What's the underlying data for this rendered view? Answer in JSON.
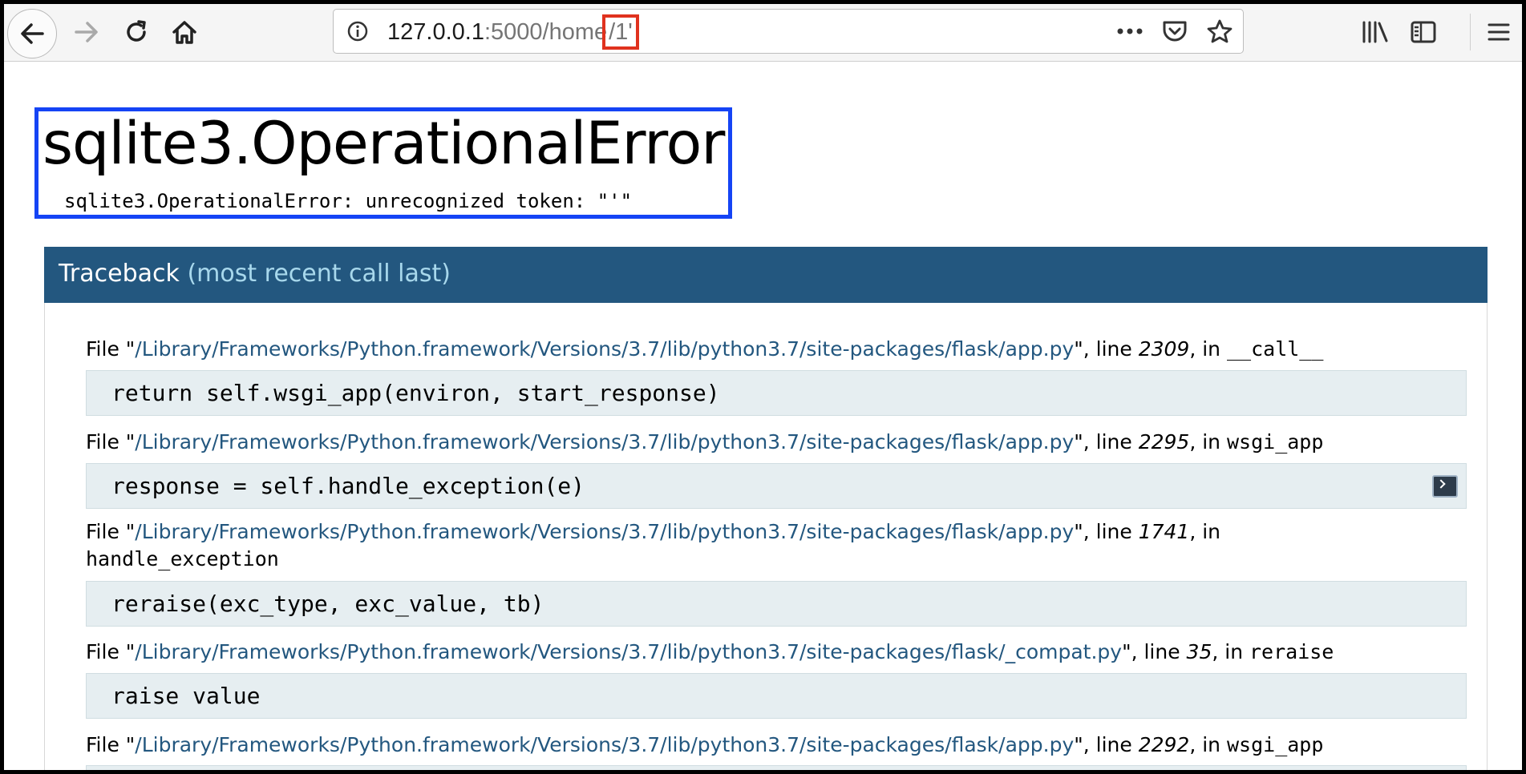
{
  "browser": {
    "url_host": "127.0.0.1",
    "url_port_path": ":5000/home",
    "url_highlight": "/1'"
  },
  "error": {
    "title": "sqlite3.OperationalError",
    "message": "sqlite3.OperationalError: unrecognized token: \"'\""
  },
  "traceback": {
    "title": "Traceback",
    "subtitle": "(most recent call last)",
    "frames": [
      {
        "file_prefix": "File \"",
        "path": "/Library/Frameworks/Python.framework/Versions/3.7/lib/python3.7/site-packages/flask/app.py",
        "line_prefix": "\", line ",
        "line": "2309",
        "in_prefix": ", in ",
        "func": "__call__",
        "code": "return self.wsgi_app(environ, start_response)"
      },
      {
        "file_prefix": "File \"",
        "path": "/Library/Frameworks/Python.framework/Versions/3.7/lib/python3.7/site-packages/flask/app.py",
        "line_prefix": "\", line ",
        "line": "2295",
        "in_prefix": ", in ",
        "func": "wsgi_app",
        "code": "response = self.handle_exception(e)"
      },
      {
        "file_prefix": "File \"",
        "path": "/Library/Frameworks/Python.framework/Versions/3.7/lib/python3.7/site-packages/flask/app.py",
        "line_prefix": "\", line ",
        "line": "1741",
        "in_prefix": ", in",
        "func": "handle_exception",
        "code": "reraise(exc_type, exc_value, tb)"
      },
      {
        "file_prefix": "File \"",
        "path": "/Library/Frameworks/Python.framework/Versions/3.7/lib/python3.7/site-packages/flask/_compat.py",
        "line_prefix": "\", line ",
        "line": "35",
        "in_prefix": ", in ",
        "func": "reraise",
        "code": "raise value"
      },
      {
        "file_prefix": "File \"",
        "path": "/Library/Frameworks/Python.framework/Versions/3.7/lib/python3.7/site-packages/flask/app.py",
        "line_prefix": "\", line ",
        "line": "2292",
        "in_prefix": ", in ",
        "func": "wsgi_app",
        "code": ""
      }
    ]
  },
  "icons": {
    "back": "back-arrow-icon",
    "forward": "forward-arrow-icon",
    "reload": "reload-icon",
    "home": "home-icon",
    "info": "info-icon",
    "more": "more-actions-icon",
    "pocket": "pocket-icon",
    "bookmark": "bookmark-star-icon",
    "library": "library-icon",
    "sidebar": "sidebar-icon",
    "menu": "hamburger-menu-icon",
    "console": "console-icon"
  },
  "colors": {
    "traceback_header": "#23577f",
    "path_text": "#23577f",
    "subtitle_text": "#a8d8ec",
    "code_bg": "#e6eef1",
    "url_highlight_outline": "#e0321e",
    "error_box_outline": "#1544f5"
  }
}
